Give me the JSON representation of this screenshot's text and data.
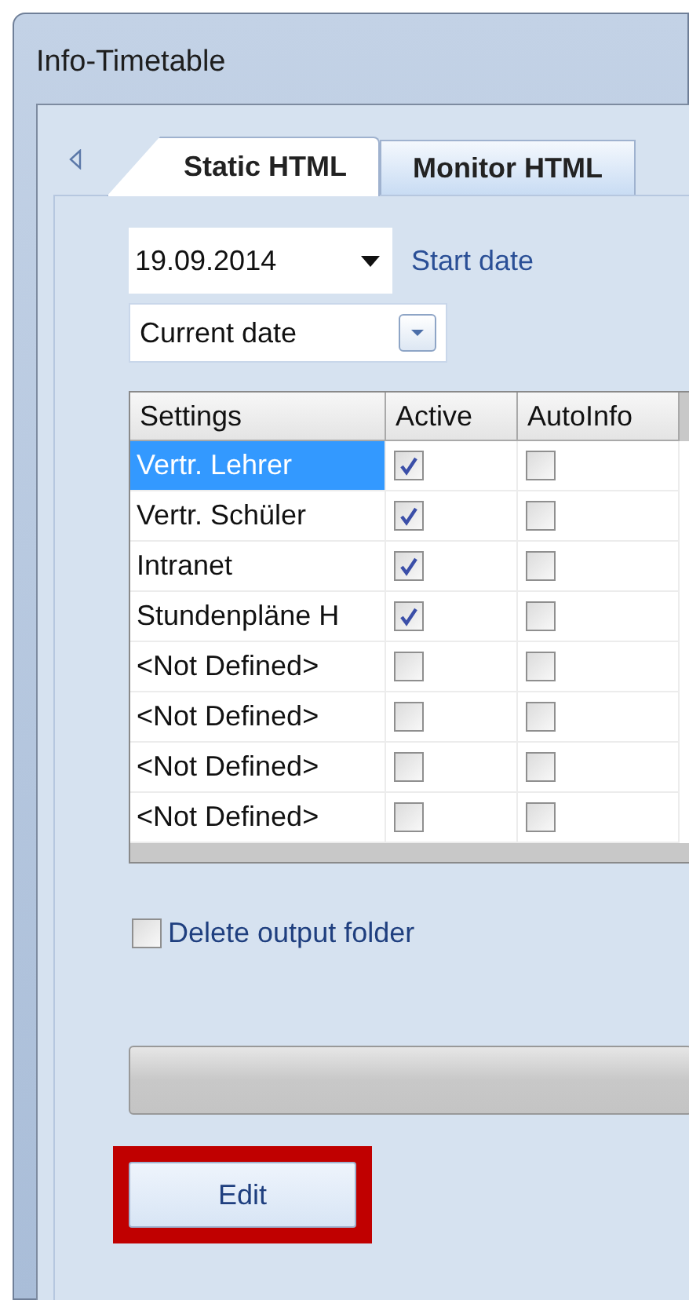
{
  "window": {
    "title": "Info-Timetable"
  },
  "tabs": [
    {
      "label": "Static HTML",
      "selected": true
    },
    {
      "label": "Monitor HTML",
      "selected": false
    }
  ],
  "start_date": {
    "value": "19.09.2014",
    "label": "Start date"
  },
  "date_mode": {
    "value": "Current date"
  },
  "table": {
    "columns": [
      "Settings",
      "Active",
      "AutoInfo"
    ],
    "rows": [
      {
        "setting": "Vertr. Lehrer",
        "selected": true,
        "active": true,
        "autoinfo": false
      },
      {
        "setting": "Vertr. Schüler",
        "selected": false,
        "active": true,
        "autoinfo": false
      },
      {
        "setting": "Intranet",
        "selected": false,
        "active": true,
        "autoinfo": false
      },
      {
        "setting": "Stundenpläne H",
        "selected": false,
        "active": true,
        "autoinfo": false
      },
      {
        "setting": "<Not Defined>",
        "selected": false,
        "active": false,
        "autoinfo": false
      },
      {
        "setting": "<Not Defined>",
        "selected": false,
        "active": false,
        "autoinfo": false
      },
      {
        "setting": "<Not Defined>",
        "selected": false,
        "active": false,
        "autoinfo": false
      },
      {
        "setting": "<Not Defined>",
        "selected": false,
        "active": false,
        "autoinfo": false
      }
    ]
  },
  "delete_output_folder": {
    "label": "Delete output folder",
    "checked": false
  },
  "progress": {
    "level": 0
  },
  "edit_button": {
    "label": "Edit",
    "highlighted": true
  }
}
